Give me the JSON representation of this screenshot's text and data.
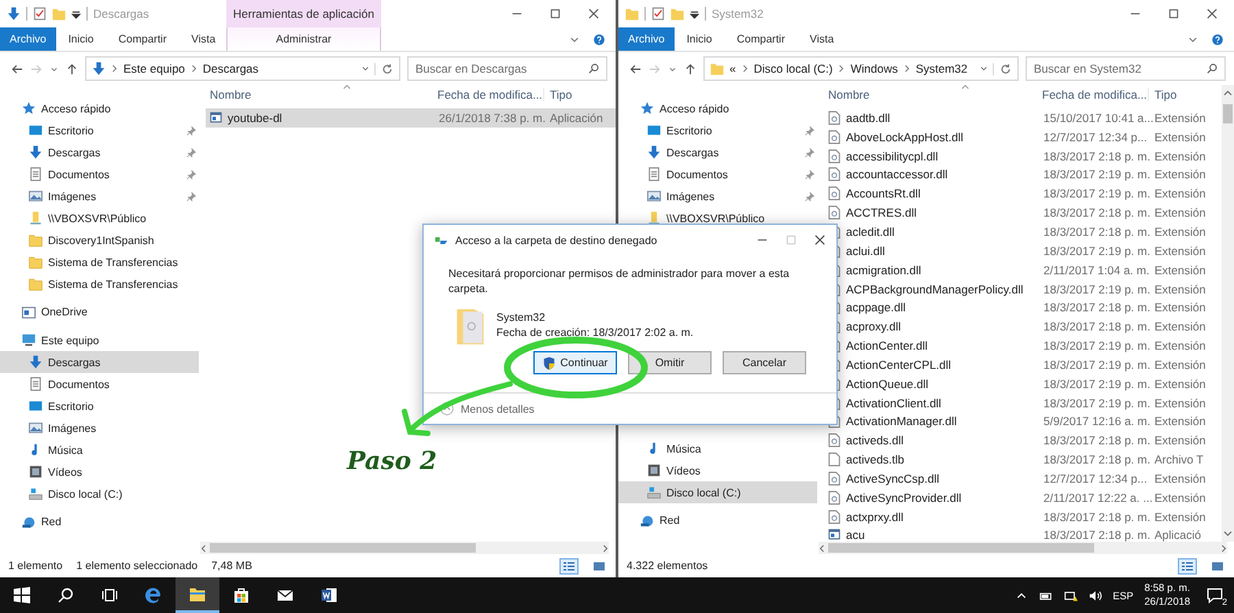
{
  "windows": [
    {
      "title": "Descargas",
      "kind": "downloads",
      "ribbon_tabs": [
        {
          "label": "Archivo",
          "kind": "file"
        },
        {
          "label": "Inicio",
          "kind": "tab"
        },
        {
          "label": "Compartir",
          "kind": "tab"
        },
        {
          "label": "Vista",
          "kind": "tab"
        }
      ],
      "contextual": {
        "header": "Herramientas de aplicación",
        "tab": "Administrar"
      },
      "address": {
        "crumbs": [
          "Este equipo",
          "Descargas"
        ]
      },
      "search_placeholder": "Buscar en Descargas",
      "columns": [
        "Nombre",
        "Fecha de modifica...",
        "Tipo"
      ],
      "rows": [
        {
          "name": "youtube-dl",
          "date": "26/1/2018 7:38 p. m.",
          "type": "Aplicación",
          "kind": "app",
          "selected": true
        }
      ],
      "sidebar": {
        "items": [
          {
            "label": "Acceso rápido",
            "kind": "star",
            "pinned": false,
            "selected": false,
            "children": [
              {
                "label": "Escritorio",
                "kind": "desktop",
                "pinned": true,
                "selected": false
              },
              {
                "label": "Descargas",
                "kind": "downloads",
                "pinned": true,
                "selected": false
              },
              {
                "label": "Documentos",
                "kind": "document",
                "pinned": true,
                "selected": false
              },
              {
                "label": "Imágenes",
                "kind": "pictures",
                "pinned": true,
                "selected": false
              },
              {
                "label": "\\\\VBOXSVR\\Público",
                "kind": "network_folder",
                "pinned": false,
                "selected": false
              },
              {
                "label": "Discovery1IntSpanish",
                "kind": "folder",
                "pinned": false,
                "selected": false
              },
              {
                "label": "Sistema de Transferencias",
                "kind": "folder",
                "pinned": false,
                "selected": false
              },
              {
                "label": "Sistema de Transferencias",
                "kind": "folder",
                "pinned": false,
                "selected": false
              }
            ]
          },
          {
            "label": "OneDrive",
            "kind": "onedrive",
            "pinned": false,
            "selected": false
          },
          {
            "label": "Este equipo",
            "kind": "pc",
            "pinned": false,
            "selected": false,
            "children": [
              {
                "label": "Descargas",
                "kind": "downloads",
                "pinned": false,
                "selected": true
              },
              {
                "label": "Documentos",
                "kind": "document",
                "pinned": false,
                "selected": false
              },
              {
                "label": "Escritorio",
                "kind": "desktop",
                "pinned": false,
                "selected": false
              },
              {
                "label": "Imágenes",
                "kind": "pictures",
                "pinned": false,
                "selected": false
              },
              {
                "label": "Música",
                "kind": "music",
                "pinned": false,
                "selected": false
              },
              {
                "label": "Vídeos",
                "kind": "video",
                "pinned": false,
                "selected": false
              },
              {
                "label": "Disco local (C:)",
                "kind": "drive",
                "pinned": false,
                "selected": false
              }
            ]
          },
          {
            "label": "Red",
            "kind": "network",
            "pinned": false,
            "selected": false
          }
        ]
      },
      "status": [
        "1 elemento",
        "1 elemento seleccionado",
        "7,48 MB"
      ],
      "vertical_scrollbar": false
    },
    {
      "title": "System32",
      "kind": "folder",
      "ribbon_tabs": [
        {
          "label": "Archivo",
          "kind": "file"
        },
        {
          "label": "Inicio",
          "kind": "tab"
        },
        {
          "label": "Compartir",
          "kind": "tab"
        },
        {
          "label": "Vista",
          "kind": "tab"
        }
      ],
      "address": {
        "overflow": "«",
        "crumbs": [
          "Disco local (C:)",
          "Windows",
          "System32"
        ]
      },
      "search_placeholder": "Buscar en System32",
      "columns": [
        "Nombre",
        "Fecha de modifica...",
        "Tipo"
      ],
      "rows": [
        {
          "name": "aadtb.dll",
          "date": "15/10/2017 10:41 a...",
          "type": "Extensión",
          "kind": "dll",
          "selected": false
        },
        {
          "name": "AboveLockAppHost.dll",
          "date": "12/7/2017 12:34 p...",
          "type": "Extensión",
          "kind": "dll",
          "selected": false
        },
        {
          "name": "accessibilitycpl.dll",
          "date": "18/3/2017 2:18 p. m.",
          "type": "Extensión",
          "kind": "dll",
          "selected": false
        },
        {
          "name": "accountaccessor.dll",
          "date": "18/3/2017 2:19 p. m.",
          "type": "Extensión",
          "kind": "dll",
          "selected": false
        },
        {
          "name": "AccountsRt.dll",
          "date": "18/3/2017 2:19 p. m.",
          "type": "Extensión",
          "kind": "dll",
          "selected": false
        },
        {
          "name": "ACCTRES.dll",
          "date": "18/3/2017 2:18 p. m.",
          "type": "Extensión",
          "kind": "dll",
          "selected": false
        },
        {
          "name": "acledit.dll",
          "date": "18/3/2017 2:18 p. m.",
          "type": "Extensión",
          "kind": "dll",
          "selected": false
        },
        {
          "name": "aclui.dll",
          "date": "18/3/2017 2:19 p. m.",
          "type": "Extensión",
          "kind": "dll",
          "selected": false
        },
        {
          "name": "acmigration.dll",
          "date": "2/11/2017 1:04 a. m.",
          "type": "Extensión",
          "kind": "dll",
          "selected": false
        },
        {
          "name": "ACPBackgroundManagerPolicy.dll",
          "date": "18/3/2017 2:19 p. m.",
          "type": "Extensión",
          "kind": "dll",
          "selected": false
        },
        {
          "name": "acppage.dll",
          "date": "18/3/2017 2:18 p. m.",
          "type": "Extensión",
          "kind": "dll",
          "selected": false
        },
        {
          "name": "acproxy.dll",
          "date": "18/3/2017 2:18 p. m.",
          "type": "Extensión",
          "kind": "dll",
          "selected": false
        },
        {
          "name": "ActionCenter.dll",
          "date": "18/3/2017 2:19 p. m.",
          "type": "Extensión",
          "kind": "dll",
          "selected": false
        },
        {
          "name": "ActionCenterCPL.dll",
          "date": "18/3/2017 2:19 p. m.",
          "type": "Extensión",
          "kind": "dll",
          "selected": false
        },
        {
          "name": "ActionQueue.dll",
          "date": "18/3/2017 2:19 p. m.",
          "type": "Extensión",
          "kind": "dll",
          "selected": false
        },
        {
          "name": "ActivationClient.dll",
          "date": "18/3/2017 2:19 p. m.",
          "type": "Extensión",
          "kind": "dll",
          "selected": false
        },
        {
          "name": "ActivationManager.dll",
          "date": "5/9/2017 12:16 a. m.",
          "type": "Extensión",
          "kind": "dll",
          "selected": false
        },
        {
          "name": "activeds.dll",
          "date": "18/3/2017 2:18 p. m.",
          "type": "Extensión",
          "kind": "dll",
          "selected": false
        },
        {
          "name": "activeds.tlb",
          "date": "18/3/2017 2:18 p. m.",
          "type": "Archivo T",
          "kind": "file",
          "selected": false
        },
        {
          "name": "ActiveSyncCsp.dll",
          "date": "12/7/2017 12:34 p...",
          "type": "Extensión",
          "kind": "dll",
          "selected": false
        },
        {
          "name": "ActiveSyncProvider.dll",
          "date": "2/11/2017 12:22 a. ...",
          "type": "Extensión",
          "kind": "dll",
          "selected": false
        },
        {
          "name": "actxprxy.dll",
          "date": "18/3/2017 2:18 p. m.",
          "type": "Extensión",
          "kind": "dll",
          "selected": false
        },
        {
          "name": "acu",
          "date": "18/3/2017 2:18 p. m.",
          "type": "Aplicació",
          "kind": "app",
          "selected": false
        }
      ],
      "sidebar": {
        "items": [
          {
            "label": "Acceso rápido",
            "kind": "star",
            "pinned": false,
            "selected": false,
            "children": [
              {
                "label": "Escritorio",
                "kind": "desktop",
                "pinned": true,
                "selected": false
              },
              {
                "label": "Descargas",
                "kind": "downloads",
                "pinned": true,
                "selected": false
              },
              {
                "label": "Documentos",
                "kind": "document",
                "pinned": true,
                "selected": false
              },
              {
                "label": "Imágenes",
                "kind": "pictures",
                "pinned": true,
                "selected": false
              },
              {
                "label": "\\\\VBOXSVR\\Público",
                "kind": "network_folder",
                "pinned": false,
                "selected": false
              }
            ]
          },
          {
            "children": [
              {
                "label": "Música",
                "kind": "music",
                "pinned": false,
                "selected": false
              },
              {
                "label": "Vídeos",
                "kind": "video",
                "pinned": false,
                "selected": false
              },
              {
                "label": "Disco local (C:)",
                "kind": "drive",
                "pinned": false,
                "selected": true
              }
            ]
          },
          {
            "label": "Red",
            "kind": "network",
            "pinned": false,
            "selected": false
          }
        ]
      },
      "status": [
        "4.322 elementos"
      ],
      "vertical_scrollbar": true
    }
  ],
  "dialog": {
    "title": "Acceso a la carpeta de destino denegado",
    "message": "Necesitará proporcionar permisos de administrador para mover a esta carpeta.",
    "item_name": "System32",
    "item_detail": "Fecha de creación: 18/3/2017 2:02 a. m.",
    "buttons": [
      {
        "label": "Continuar",
        "kind": "shield"
      },
      {
        "label": "Omitir",
        "kind": "plain"
      },
      {
        "label": "Cancelar",
        "kind": "plain"
      }
    ],
    "details_toggle": "Menos detalles"
  },
  "annotation": {
    "label": "Paso 2"
  },
  "taskbar": {
    "apps": [
      {
        "kind": "start",
        "active": false
      },
      {
        "kind": "search",
        "active": false
      },
      {
        "kind": "task_view",
        "active": false
      },
      {
        "kind": "edge",
        "active": false
      },
      {
        "kind": "explorer",
        "active": true
      },
      {
        "kind": "store",
        "active": false
      },
      {
        "kind": "mail",
        "active": false
      },
      {
        "kind": "word",
        "active": false
      }
    ],
    "language": "ESP",
    "time": "8:58 p. m.",
    "date": "26/1/2018",
    "notifications": "2"
  }
}
